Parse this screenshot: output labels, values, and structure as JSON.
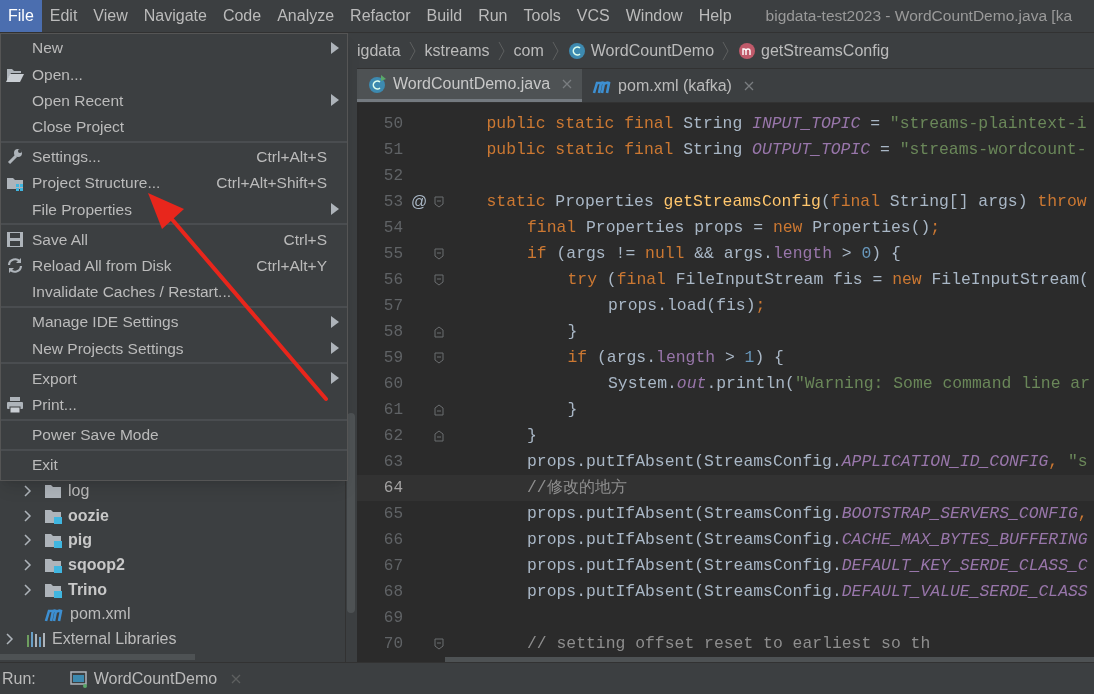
{
  "menu_bar": {
    "items": [
      {
        "label": "File",
        "selected": true
      },
      {
        "label": "Edit",
        "selected": false
      },
      {
        "label": "View",
        "selected": false
      },
      {
        "label": "Navigate",
        "selected": false
      },
      {
        "label": "Code",
        "selected": false
      },
      {
        "label": "Analyze",
        "selected": false
      },
      {
        "label": "Refactor",
        "selected": false
      },
      {
        "label": "Build",
        "selected": false
      },
      {
        "label": "Run",
        "selected": false
      },
      {
        "label": "Tools",
        "selected": false
      },
      {
        "label": "VCS",
        "selected": false
      },
      {
        "label": "Window",
        "selected": false
      },
      {
        "label": "Help",
        "selected": false
      }
    ],
    "window_title": "bigdata-test2023 - WordCountDemo.java [ka"
  },
  "file_menu": {
    "groups": [
      [
        {
          "label": "New",
          "kind": "plain",
          "submenu": true
        },
        {
          "label": "Open...",
          "kind": "open",
          "submenu": false
        },
        {
          "label": "Open Recent",
          "kind": "plain",
          "submenu": true
        },
        {
          "label": "Close Project",
          "kind": "plain",
          "submenu": false
        }
      ],
      [
        {
          "label": "Settings...",
          "kind": "settings",
          "shortcut": "Ctrl+Alt+S",
          "submenu": false
        },
        {
          "label": "Project Structure...",
          "kind": "structure",
          "shortcut": "Ctrl+Alt+Shift+S",
          "submenu": false
        },
        {
          "label": "File Properties",
          "kind": "plain",
          "submenu": true
        }
      ],
      [
        {
          "label": "Save All",
          "kind": "save",
          "shortcut": "Ctrl+S",
          "submenu": false
        },
        {
          "label": "Reload All from Disk",
          "kind": "reload",
          "shortcut": "Ctrl+Alt+Y",
          "submenu": false
        },
        {
          "label": "Invalidate Caches / Restart...",
          "kind": "plain",
          "submenu": false
        }
      ],
      [
        {
          "label": "Manage IDE Settings",
          "kind": "plain",
          "submenu": true
        },
        {
          "label": "New Projects Settings",
          "kind": "plain",
          "submenu": true
        }
      ],
      [
        {
          "label": "Export",
          "kind": "plain",
          "submenu": true
        },
        {
          "label": "Print...",
          "kind": "print",
          "submenu": false
        }
      ],
      [
        {
          "label": "Power Save Mode",
          "kind": "plain",
          "submenu": false
        }
      ],
      [
        {
          "label": "Exit",
          "kind": "plain",
          "submenu": false
        }
      ]
    ]
  },
  "breadcrumbs": [
    {
      "label": "igdata",
      "kind": "text"
    },
    {
      "label": "kstreams",
      "kind": "text"
    },
    {
      "label": "com",
      "kind": "text"
    },
    {
      "label": "WordCountDemo",
      "kind": "class"
    },
    {
      "label": "getStreamsConfig",
      "kind": "method"
    }
  ],
  "tabs": [
    {
      "label": "WordCountDemo.java",
      "kind": "class",
      "selected": true
    },
    {
      "label": "pom.xml (kafka)",
      "kind": "maven",
      "selected": false
    }
  ],
  "project_tree": [
    {
      "children": [
        {
          "label": "log",
          "kind": "folder",
          "expanded": false
        },
        {
          "label": "oozie",
          "kind": "module",
          "expanded": false
        },
        {
          "label": "pig",
          "kind": "module",
          "expanded": false
        },
        {
          "label": "sqoop2",
          "kind": "module",
          "expanded": false
        },
        {
          "label": "Trino",
          "kind": "module",
          "expanded": false
        },
        {
          "label": "pom.xml",
          "kind": "maven"
        }
      ]
    },
    {
      "label": "External Libraries",
      "kind": "libraries",
      "expanded": false
    }
  ],
  "editor": {
    "lines": [
      {
        "number": "50",
        "current": false,
        "fold_start": false,
        "fold_end": false,
        "tokens": [
          {
            "kind": "kw",
            "t": "public static final"
          },
          {
            "kind": "text",
            "t": " String "
          },
          {
            "kind": "const",
            "t": "INPUT_TOPIC"
          },
          {
            "kind": "text",
            "t": " = "
          },
          {
            "kind": "str",
            "t": "\"streams-plaintext-i"
          }
        ]
      },
      {
        "number": "51",
        "current": false,
        "fold_start": false,
        "fold_end": false,
        "tokens": [
          {
            "kind": "kw",
            "t": "public static final"
          },
          {
            "kind": "text",
            "t": " String "
          },
          {
            "kind": "const",
            "t": "OUTPUT_TOPIC"
          },
          {
            "kind": "text",
            "t": " = "
          },
          {
            "kind": "str",
            "t": "\"streams-wordcount-"
          }
        ]
      },
      {
        "number": "52",
        "current": false,
        "fold_start": false,
        "fold_end": false
      },
      {
        "number": "53",
        "current": false,
        "gutter": "@",
        "fold_start": true,
        "fold_end": false,
        "tokens": [
          {
            "kind": "kw",
            "t": "static"
          },
          {
            "kind": "text",
            "t": " Properties "
          },
          {
            "kind": "method",
            "t": "getStreamsConfig"
          },
          {
            "kind": "text",
            "t": "("
          },
          {
            "kind": "kw",
            "t": "final"
          },
          {
            "kind": "text",
            "t": " String[] args) "
          },
          {
            "kind": "kw",
            "t": "throw"
          }
        ]
      },
      {
        "number": "54",
        "current": false,
        "fold_start": false,
        "fold_end": false,
        "tokens": [
          {
            "kind": "kw",
            "t": "final"
          },
          {
            "kind": "text",
            "t": " Properties props = "
          },
          {
            "kind": "kw",
            "t": "new"
          },
          {
            "kind": "text",
            "t": " Properties()"
          },
          {
            "kind": "kw",
            "t": ";"
          }
        ]
      },
      {
        "number": "55",
        "current": false,
        "fold_start": true,
        "fold_end": false,
        "tokens": [
          {
            "kind": "kw",
            "t": "if"
          },
          {
            "kind": "text",
            "t": " (args != "
          },
          {
            "kind": "kw",
            "t": "null"
          },
          {
            "kind": "text",
            "t": " && args."
          },
          {
            "kind": "field",
            "t": "length"
          },
          {
            "kind": "text",
            "t": " > "
          },
          {
            "kind": "num",
            "t": "0"
          },
          {
            "kind": "text",
            "t": ") {"
          }
        ]
      },
      {
        "number": "56",
        "current": false,
        "fold_start": true,
        "fold_end": false,
        "tokens": [
          {
            "kind": "kw",
            "t": "try"
          },
          {
            "kind": "text",
            "t": " ("
          },
          {
            "kind": "kw",
            "t": "final"
          },
          {
            "kind": "text",
            "t": " FileInputStream fis = "
          },
          {
            "kind": "kw",
            "t": "new"
          },
          {
            "kind": "text",
            "t": " FileInputStream("
          }
        ]
      },
      {
        "number": "57",
        "current": false,
        "fold_start": false,
        "fold_end": false,
        "tokens": [
          {
            "kind": "text",
            "t": "props.load(fis)"
          },
          {
            "kind": "kw",
            "t": ";"
          }
        ]
      },
      {
        "number": "58",
        "current": false,
        "fold_start": false,
        "fold_end": true,
        "tokens": [
          {
            "kind": "text",
            "t": "}"
          }
        ]
      },
      {
        "number": "59",
        "current": false,
        "fold_start": true,
        "fold_end": false,
        "tokens": [
          {
            "kind": "kw",
            "t": "if"
          },
          {
            "kind": "text",
            "t": " (args."
          },
          {
            "kind": "field",
            "t": "length"
          },
          {
            "kind": "text",
            "t": " > "
          },
          {
            "kind": "num",
            "t": "1"
          },
          {
            "kind": "text",
            "t": ") {"
          }
        ]
      },
      {
        "number": "60",
        "current": false,
        "fold_start": false,
        "fold_end": false,
        "tokens": [
          {
            "kind": "text",
            "t": "System."
          },
          {
            "kind": "const",
            "t": "out"
          },
          {
            "kind": "text",
            "t": ".println("
          },
          {
            "kind": "str",
            "t": "\"Warning: Some command line ar"
          }
        ]
      },
      {
        "number": "61",
        "current": false,
        "fold_start": false,
        "fold_end": true,
        "tokens": [
          {
            "kind": "text",
            "t": "}"
          }
        ]
      },
      {
        "number": "62",
        "current": false,
        "fold_start": false,
        "fold_end": true,
        "tokens": [
          {
            "kind": "text",
            "t": "}"
          }
        ]
      },
      {
        "number": "63",
        "current": false,
        "fold_start": false,
        "fold_end": false,
        "tokens": [
          {
            "kind": "text",
            "t": "props.putIfAbsent(StreamsConfig."
          },
          {
            "kind": "const",
            "t": "APPLICATION_ID_CONFIG"
          },
          {
            "kind": "kw",
            "t": ","
          },
          {
            "kind": "str",
            "t": " \"s"
          }
        ]
      },
      {
        "number": "64",
        "current": true,
        "fold_start": false,
        "fold_end": false,
        "tokens": [
          {
            "kind": "comment",
            "t": "//修改的地方"
          }
        ]
      },
      {
        "number": "65",
        "current": false,
        "fold_start": false,
        "fold_end": false,
        "tokens": [
          {
            "kind": "text",
            "t": "props.putIfAbsent(StreamsConfig."
          },
          {
            "kind": "const",
            "t": "BOOTSTRAP_SERVERS_CONFIG"
          },
          {
            "kind": "kw",
            "t": ","
          }
        ]
      },
      {
        "number": "66",
        "current": false,
        "fold_start": false,
        "fold_end": false,
        "tokens": [
          {
            "kind": "text",
            "t": "props.putIfAbsent(StreamsConfig."
          },
          {
            "kind": "const",
            "t": "CACHE_MAX_BYTES_BUFFERING"
          }
        ]
      },
      {
        "number": "67",
        "current": false,
        "fold_start": false,
        "fold_end": false,
        "tokens": [
          {
            "kind": "text",
            "t": "props.putIfAbsent(StreamsConfig."
          },
          {
            "kind": "const",
            "t": "DEFAULT_KEY_SERDE_CLASS_C"
          }
        ]
      },
      {
        "number": "68",
        "current": false,
        "fold_start": false,
        "fold_end": false,
        "tokens": [
          {
            "kind": "text",
            "t": "props.putIfAbsent(StreamsConfig."
          },
          {
            "kind": "const",
            "t": "DEFAULT_VALUE_SERDE_CLASS"
          }
        ]
      },
      {
        "number": "69",
        "current": false,
        "fold_start": false,
        "fold_end": false
      },
      {
        "number": "70",
        "current": false,
        "fold_start": true,
        "fold_end": false,
        "tokens": [
          {
            "kind": "comment",
            "t": "// setting offset reset to earliest so th"
          }
        ]
      }
    ]
  },
  "run_bar": {
    "label": "Run:",
    "tab": "WordCountDemo"
  }
}
